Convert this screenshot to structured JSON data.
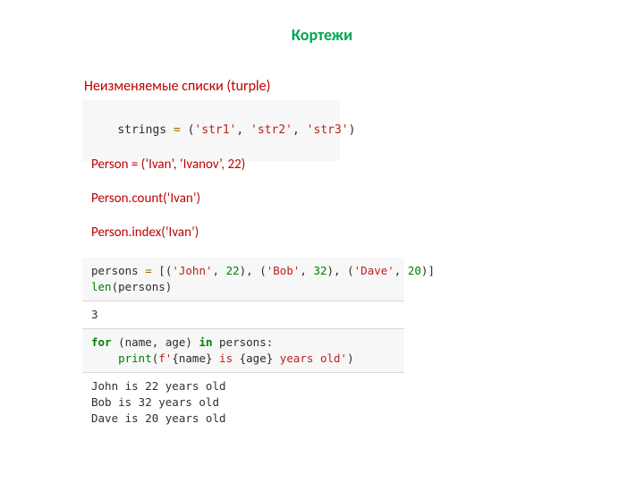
{
  "title": "Кортежи",
  "subtitle": "Неизменяемые списки (turple)",
  "snippet1": {
    "var": "strings",
    "assign": "=",
    "open": "(",
    "s1": "'str1'",
    "s2": "'str2'",
    "s3": "'str3'",
    "c1": ",",
    "c2": ",",
    "close": ")"
  },
  "lines": {
    "a": "Person = (‘Ivan’, ‘Ivanov’, 22)",
    "b": "Person.count(‘Ivan’)",
    "c": "Person.index(‘Ivan’)"
  },
  "cell1": {
    "persons": "persons",
    "assign": "=",
    "open": "[",
    "p1o": "(",
    "p1n": "'John'",
    "p1c1": ",",
    "p1v": "22",
    "p1x": ")",
    "c12": ",",
    "p2o": "(",
    "p2n": "'Bob'",
    "p2c1": ",",
    "p2v": "32",
    "p2x": ")",
    "c23": ",",
    "p3o": "(",
    "p3n": "'Dave'",
    "p3c1": ",",
    "p3v": "20",
    "p3x": ")",
    "close": "]",
    "len": "len",
    "leno": "(",
    "lenarg": "persons",
    "lenc": ")"
  },
  "out1": "3",
  "cell2": {
    "for": "for",
    "open": "(",
    "name": "name",
    "c1": ",",
    "age": "age",
    "close": ")",
    "in": "in",
    "iter": "persons",
    "colon": ":",
    "indent": "    ",
    "print": "print",
    "popen": "(",
    "fq0": "f'",
    "i1o": "{",
    "i1": "name",
    "i1c": "}",
    "mid": " is ",
    "i2o": "{",
    "i2": "age",
    "i2c": "}",
    "tail": " years old'",
    "pclose": ")"
  },
  "out2": "John is 22 years old\nBob is 32 years old\nDave is 20 years old"
}
